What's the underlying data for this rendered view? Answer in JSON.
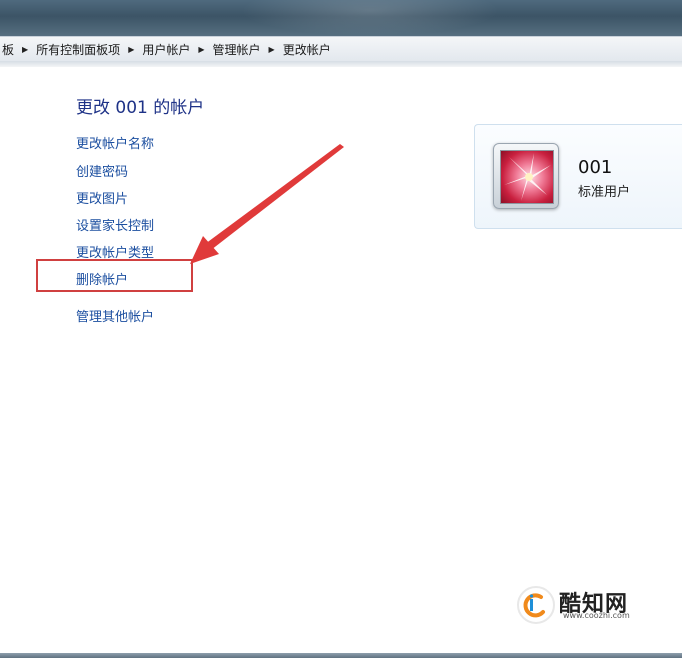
{
  "address_bar": {
    "crumbs": [
      "板",
      "所有控制面板项",
      "用户帐户",
      "管理帐户",
      "更改帐户"
    ]
  },
  "page": {
    "title": "更改 001 的帐户"
  },
  "links": {
    "rename": "更改帐户名称",
    "create_password": "创建密码",
    "change_picture": "更改图片",
    "parental_controls": "设置家长控制",
    "change_type": "更改帐户类型",
    "delete_account": "删除帐户",
    "manage_other": "管理其他帐户"
  },
  "account": {
    "name": "001",
    "type": "标准用户"
  },
  "watermark": {
    "title": "酷知网",
    "url": "www.coozhi.com"
  },
  "colors": {
    "heading": "#1e3287",
    "link": "#1c4fa0",
    "highlight": "#d04040",
    "arrow": "#e03a3a"
  }
}
